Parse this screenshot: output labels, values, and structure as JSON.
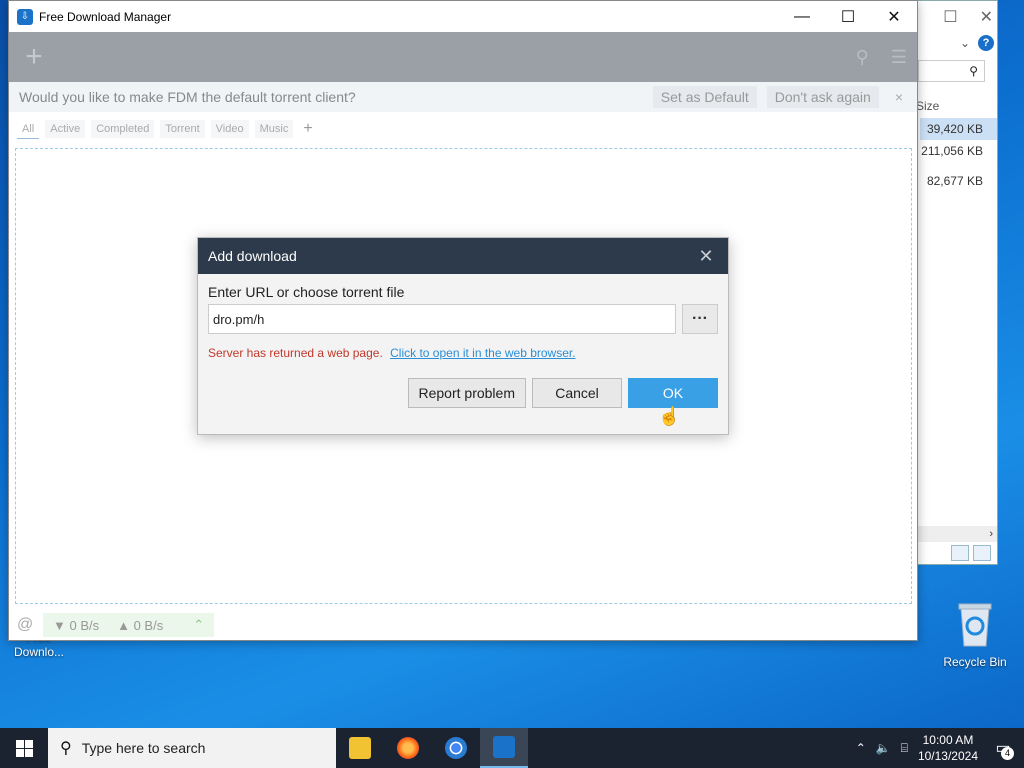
{
  "desktop": {
    "recycle_bin_label": "Recycle Bin",
    "fdm_icon_label": "Free Downlo..."
  },
  "explorer": {
    "size_header": "Size",
    "sizes": [
      "39,420 KB",
      "211,056 KB",
      "82,677 KB"
    ]
  },
  "app": {
    "title": "Free Download Manager",
    "window_buttons": {
      "minimize": "—",
      "maximize": "☐",
      "close": "✕"
    },
    "notification": {
      "message": "Would you like to make FDM the default torrent client?",
      "set_default": "Set as Default",
      "dont_ask": "Don't ask again",
      "close": "×"
    },
    "tabs": [
      {
        "label": "All"
      },
      {
        "label": "Active"
      },
      {
        "label": "Completed"
      },
      {
        "label": "Torrent"
      },
      {
        "label": "Video"
      },
      {
        "label": "Music"
      }
    ],
    "add_tab": "+",
    "status": {
      "down_speed": "▼ 0 B/s",
      "up_speed": "▲ 0 B/s"
    }
  },
  "dialog": {
    "title": "Add download",
    "close": "✕",
    "prompt": "Enter URL or choose torrent file",
    "url_value": "dro.pm/h",
    "browse": "···",
    "error_text": "Server has returned a web page.",
    "error_link": "Click to open it in the web browser.",
    "report_button": "Report problem",
    "cancel_button": "Cancel",
    "ok_button": "OK"
  },
  "taskbar": {
    "search_placeholder": "Type here to search",
    "time": "10:00 AM",
    "date": "10/13/2024",
    "notification_count": "4"
  },
  "colors": {
    "accent": "#3aa0e6",
    "dialog_title_bg": "#2c3a4b",
    "error_text": "#c0392b",
    "link": "#2a8fd6"
  }
}
